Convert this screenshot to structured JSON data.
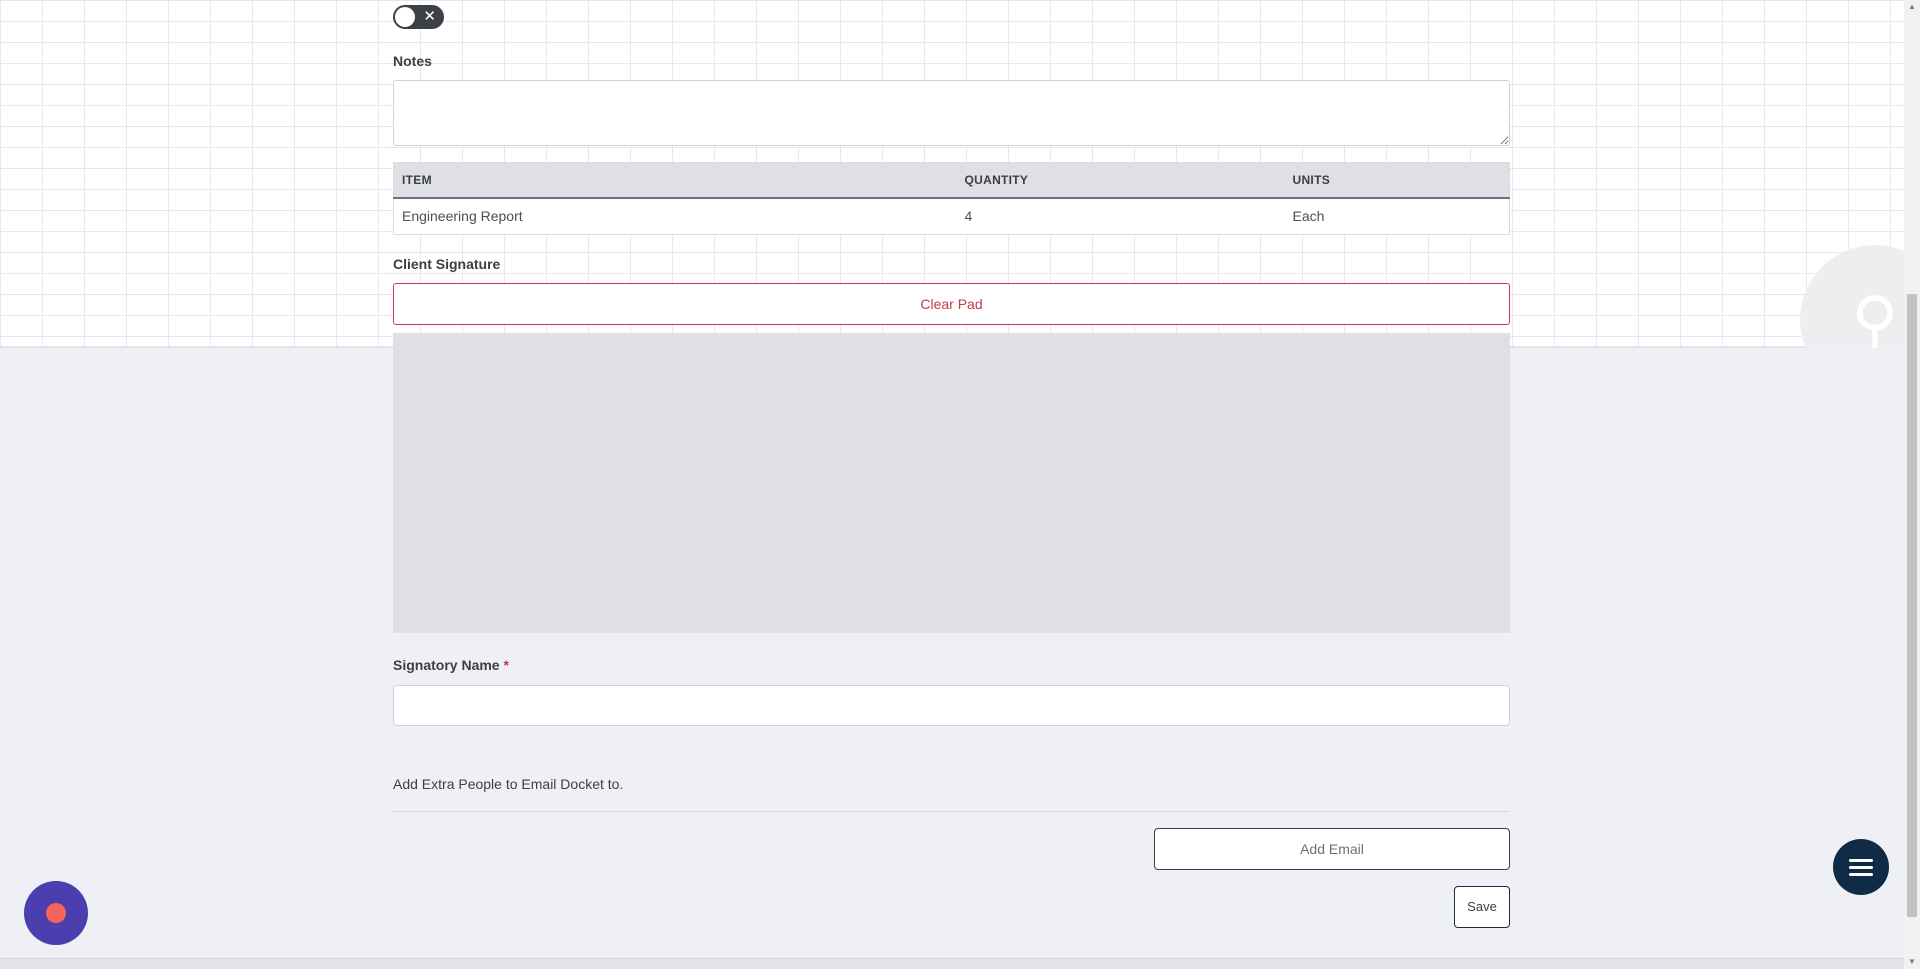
{
  "form": {
    "toggle_state": "off",
    "notes_label": "Notes",
    "notes_value": "",
    "items_table": {
      "headers": [
        "ITEM",
        "QUANTITY",
        "UNITS"
      ],
      "rows": [
        [
          "Engineering Report",
          "4",
          "Each"
        ]
      ]
    },
    "client_signature_label": "Client Signature",
    "clear_pad_label": "Clear Pad",
    "signatory_name_label": "Signatory Name",
    "required_marker": "*",
    "signatory_name_value": "",
    "extra_people_text": "Add Extra People to Email Docket to.",
    "add_email_label": "Add Email",
    "save_label": "Save"
  },
  "colors": {
    "accent_danger": "#c7394a",
    "fab_menu": "#0f2b45",
    "fab_record": "#4b3fb0",
    "record_dot": "#f4645c"
  },
  "icons": {
    "toggle_off": "close-icon",
    "menu": "hamburger-icon",
    "record": "record-dot-icon"
  }
}
